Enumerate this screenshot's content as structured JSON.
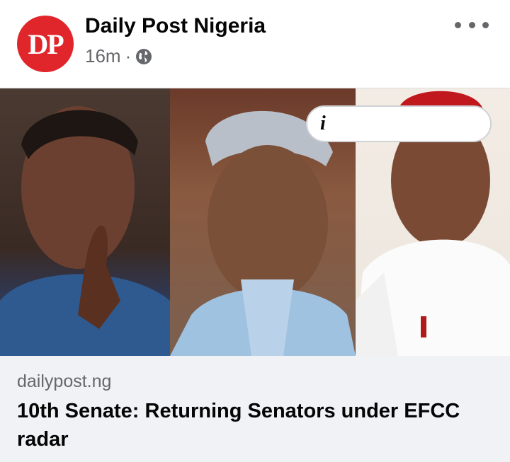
{
  "post": {
    "page_name": "Daily Post Nigeria",
    "avatar_text": "DP",
    "timestamp": "16m",
    "separator": "·",
    "privacy_icon": "globe-icon",
    "more_icon": "more-options-icon"
  },
  "image": {
    "info_icon_text": "i",
    "colors": {
      "avatar": "#e0262a"
    }
  },
  "link": {
    "domain": "dailypost.ng",
    "title": "10th Senate: Returning Senators under EFCC radar"
  }
}
